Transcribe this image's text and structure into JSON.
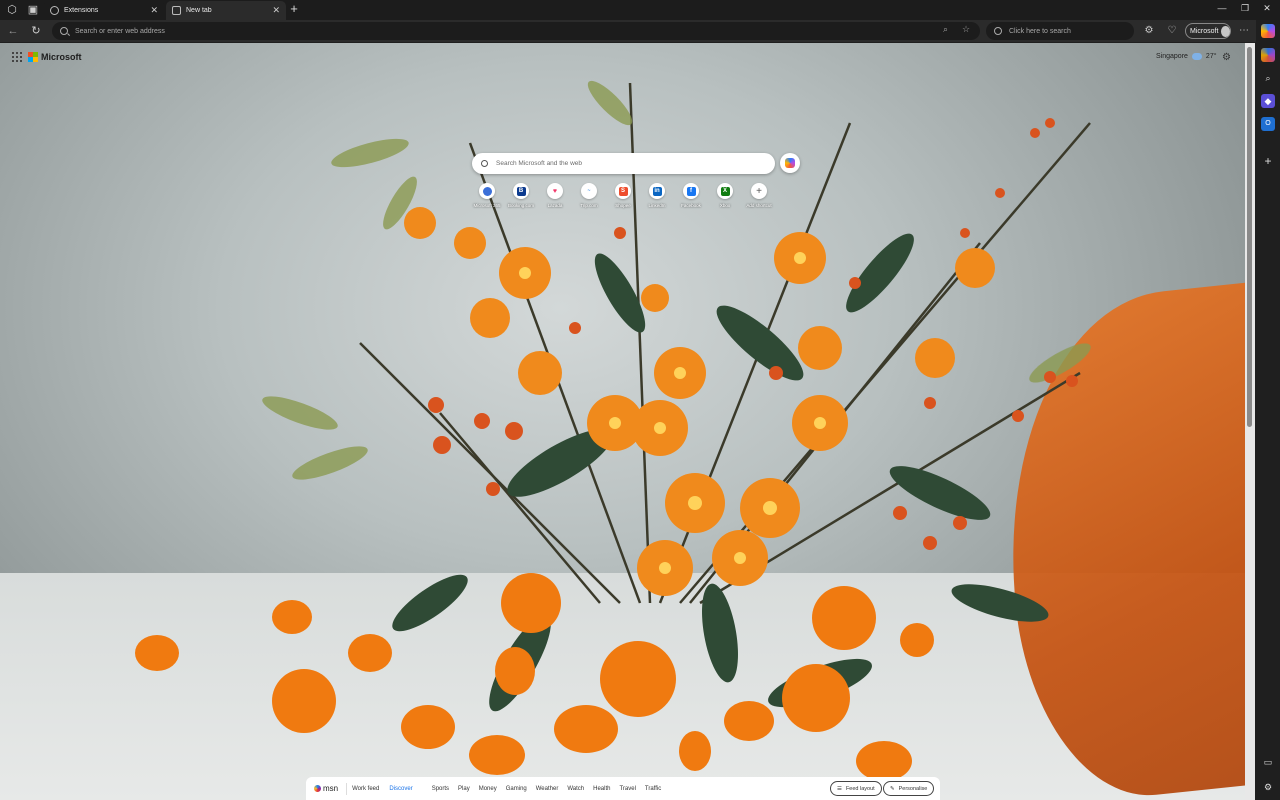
{
  "browser": {
    "tabs": [
      {
        "label": "Extensions",
        "active": false
      },
      {
        "label": "New tab",
        "active": true
      }
    ],
    "address_placeholder": "Search or enter web address",
    "web_search_placeholder": "Click here to search",
    "profile_label": "Microsoft"
  },
  "ntp": {
    "brand": "Microsoft",
    "weather": {
      "location": "Singapore",
      "temperature": "27°"
    },
    "search_placeholder": "Search Microsoft and the web",
    "shortcuts": [
      {
        "label": "Microsoft 365",
        "icon": "m365-icon",
        "color": "#3b6fd8"
      },
      {
        "label": "Booking.com",
        "icon": "booking-icon",
        "color": "#0c3b8f"
      },
      {
        "label": "Lazada",
        "icon": "lazada-icon",
        "color": "#f2376a"
      },
      {
        "label": "Trip.com",
        "icon": "trip-icon",
        "color": "#3a8ee6"
      },
      {
        "label": "Shopee",
        "icon": "shopee-icon",
        "color": "#ee4d2d"
      },
      {
        "label": "LinkedIn",
        "icon": "linkedin-icon",
        "color": "#0a66c2"
      },
      {
        "label": "Facebook",
        "icon": "facebook-icon",
        "color": "#1877f2"
      },
      {
        "label": "Xbox",
        "icon": "xbox-icon",
        "color": "#107c10"
      },
      {
        "label": "Add shortcut",
        "icon": "plus-icon",
        "color": "#666666"
      }
    ]
  },
  "feed": {
    "logo": "msn",
    "tabs": [
      "Work feed",
      "Discover"
    ],
    "selected_tab": "Discover",
    "links": [
      "Sports",
      "Play",
      "Money",
      "Gaming",
      "Weather",
      "Watch",
      "Health",
      "Travel",
      "Traffic"
    ],
    "feed_layout_label": "Feed layout",
    "personalise_label": "Personalise"
  }
}
